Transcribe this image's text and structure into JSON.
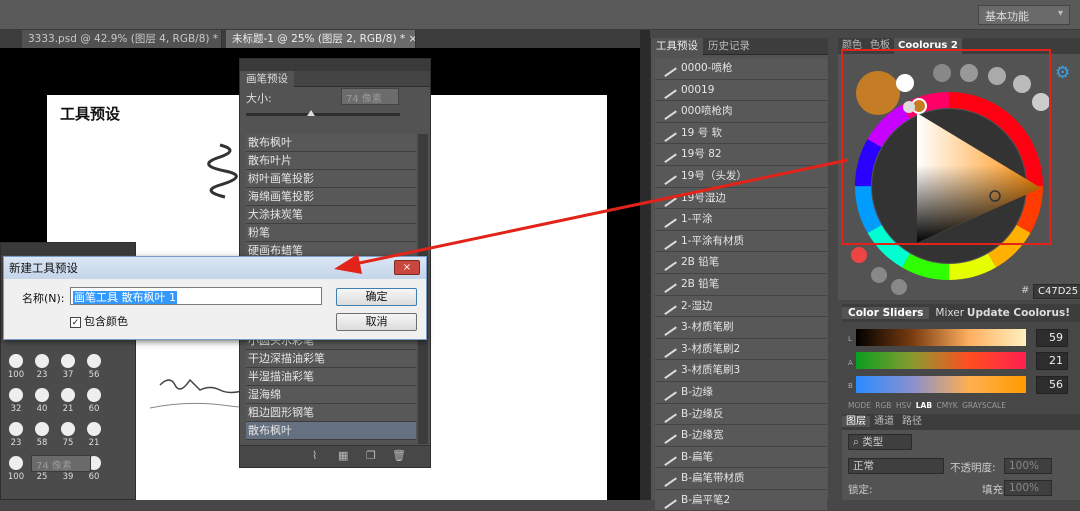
{
  "workspace_selector": "基本功能",
  "doc_tabs": [
    {
      "label": "3333.psd @ 42.9% (图层 4, RGB/8) *",
      "close": "×"
    },
    {
      "label": "未标题-1 @ 25% (图层 2, RGB/8) *",
      "close": "×"
    }
  ],
  "canvas": {
    "title": "工具预设"
  },
  "brush_preset_panel": {
    "tab": "画笔预设",
    "size_label": "大小:",
    "size_value": "74 像素",
    "items": [
      "散布枫叶",
      "散布叶片",
      "树叶画笔投影",
      "海绵画笔投影",
      "大涂抹炭笔",
      "粉笔",
      "硬画布蜡笔",
      "",
      "",
      "",
      "",
      "小圆头水彩笔",
      "干边深描油彩笔",
      "半湿描油彩笔",
      "湿海绵",
      "粗边圆形钢笔",
      "散布枫叶"
    ],
    "selected_index": 16
  },
  "left_brush_panel": {
    "cells": [
      "100",
      "23",
      "37",
      "56",
      "32",
      "40",
      "21",
      "60",
      "23",
      "58",
      "75",
      "21",
      "",
      "",
      "",
      ""
    ],
    "cells_row2": [
      "100",
      "25",
      "39",
      "60"
    ],
    "size_value": "74 像素"
  },
  "dialog": {
    "title": "新建工具预设",
    "close": "×",
    "name_label": "名称(N):",
    "name_value": "画笔工具 散布枫叶 1",
    "checkbox_label": "包含颜色",
    "checkbox_checked": "✓",
    "ok": "确定",
    "cancel": "取消"
  },
  "tool_presets": {
    "tabs": [
      "工具预设",
      "历史记录"
    ],
    "items": [
      "0000-喷枪",
      "00019",
      "000喷枪肉",
      "19 号 软",
      "19号 82",
      "19号（头发）",
      "19号湿边",
      "1-平涂",
      "1-平涂有材质",
      "2B 铅笔",
      "2B 铅笔",
      "2-湿边",
      "3-材质笔刷",
      "3-材质笔刷2",
      "3-材质笔刷3",
      "B-边缘",
      "B-边缘反",
      "B-边缘宽",
      "B-扁笔",
      "B-扁笔带材质",
      "B-扁平笔2"
    ]
  },
  "color_panel": {
    "tabs": [
      "颜色",
      "色板",
      "Coolorus 2"
    ],
    "hex": "C47D25",
    "hash": "#",
    "swatch": "#c47d25"
  },
  "sliders": {
    "tabs": [
      "Color Sliders",
      "Mixer"
    ],
    "update": "Update Coolorus!",
    "rows": [
      {
        "label": "L",
        "value": "59"
      },
      {
        "label": "A",
        "value": "21"
      },
      {
        "label": "B",
        "value": "56"
      }
    ],
    "modes": [
      "MODE",
      "RGB",
      "HSV",
      "LAB",
      "CMYK",
      "GRAYSCALE"
    ],
    "active_mode": "LAB"
  },
  "layers": {
    "tabs": [
      "图层",
      "通道",
      "路径"
    ],
    "filter": "类型",
    "blend": "正常",
    "opacity_label": "不透明度:",
    "opacity": "100%",
    "lock_label": "锁定:",
    "fill_label": "填充:",
    "fill": "100%"
  }
}
